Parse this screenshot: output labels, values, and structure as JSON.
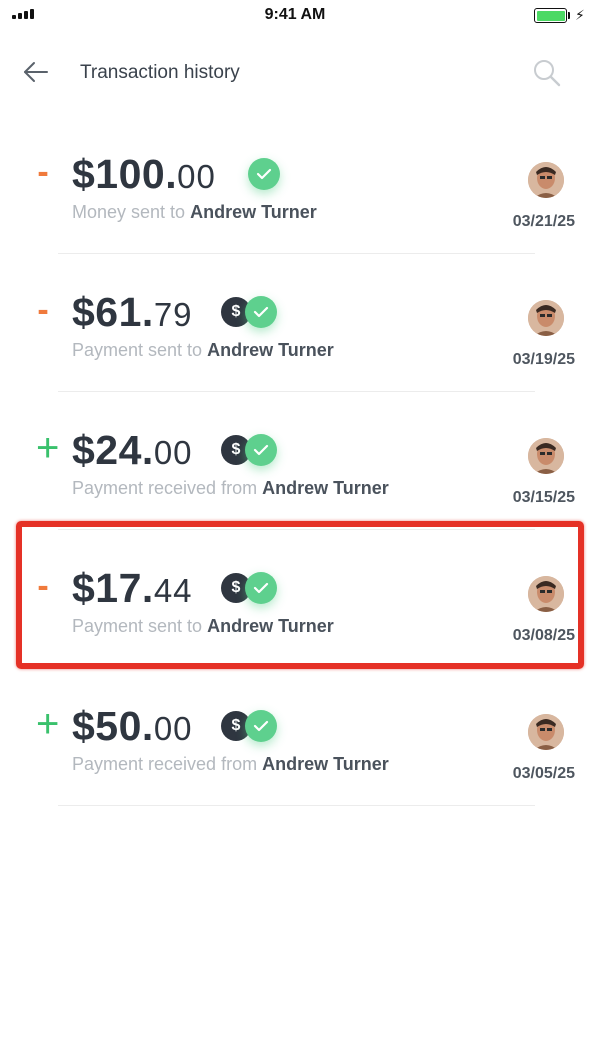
{
  "status_bar": {
    "time": "9:41 AM"
  },
  "header": {
    "title": "Transaction history",
    "back_icon": "arrow-left-icon",
    "search_icon": "search-icon"
  },
  "colors": {
    "minus": "#f07a3c",
    "plus": "#39c16c",
    "check": "#5ed08e",
    "highlight": "#e53126",
    "text_dark": "#2f3640",
    "text_muted": "#b3b8be"
  },
  "transactions": [
    {
      "sign": "-",
      "amount_main": "$100.",
      "amount_cents": "00",
      "has_dollar_badge": false,
      "verified": true,
      "desc_prefix": "Money sent to ",
      "name": "Andrew Turner",
      "date": "03/21/25"
    },
    {
      "sign": "-",
      "amount_main": "$61.",
      "amount_cents": "79",
      "has_dollar_badge": true,
      "verified": true,
      "desc_prefix": "Payment sent to ",
      "name": "Andrew Turner",
      "date": "03/19/25"
    },
    {
      "sign": "+",
      "amount_main": "$24.",
      "amount_cents": "00",
      "has_dollar_badge": true,
      "verified": true,
      "desc_prefix": "Payment received from ",
      "name": "Andrew Turner",
      "date": "03/15/25"
    },
    {
      "sign": "-",
      "amount_main": "$17.",
      "amount_cents": "44",
      "has_dollar_badge": true,
      "verified": true,
      "desc_prefix": "Payment sent to ",
      "name": "Andrew Turner",
      "date": "03/08/25",
      "highlighted": true
    },
    {
      "sign": "+",
      "amount_main": "$50.",
      "amount_cents": "00",
      "has_dollar_badge": true,
      "verified": true,
      "desc_prefix": "Payment received from ",
      "name": "Andrew Turner",
      "date": "03/05/25"
    }
  ],
  "badge_dollar_symbol": "$"
}
